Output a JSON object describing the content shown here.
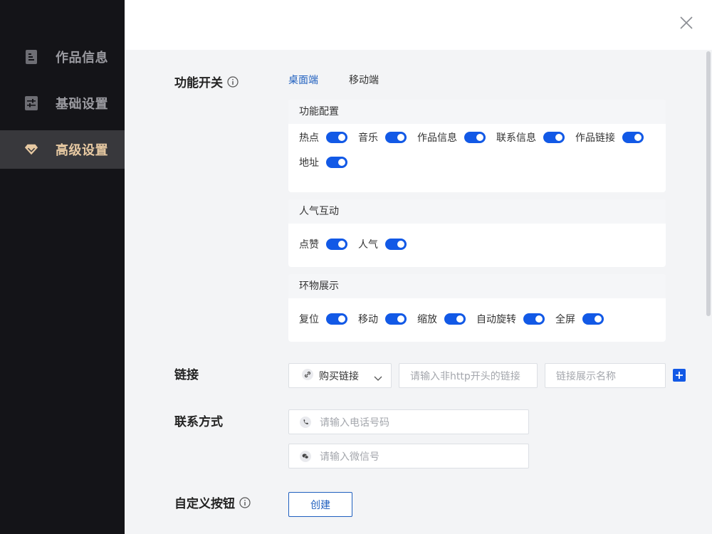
{
  "sidebar": {
    "items": [
      {
        "label": "作品信息",
        "icon": "document-icon",
        "active": false
      },
      {
        "label": "基础设置",
        "icon": "sliders-icon",
        "active": false
      },
      {
        "label": "高级设置",
        "icon": "diamond-icon",
        "active": true
      }
    ]
  },
  "header": {
    "close_icon": "close-icon"
  },
  "features": {
    "label": "功能开关",
    "tabs": [
      {
        "label": "桌面端",
        "active": true
      },
      {
        "label": "移动端",
        "active": false
      }
    ],
    "groups": [
      {
        "title": "功能配置",
        "toggles": [
          {
            "label": "热点",
            "on": true
          },
          {
            "label": "音乐",
            "on": true
          },
          {
            "label": "作品信息",
            "on": true
          },
          {
            "label": "联系信息",
            "on": true
          },
          {
            "label": "作品链接",
            "on": true
          },
          {
            "label": "地址",
            "on": true
          }
        ]
      },
      {
        "title": "人气互动",
        "toggles": [
          {
            "label": "点赞",
            "on": true
          },
          {
            "label": "人气",
            "on": true
          }
        ]
      },
      {
        "title": "环物展示",
        "toggles": [
          {
            "label": "复位",
            "on": true
          },
          {
            "label": "移动",
            "on": true
          },
          {
            "label": "缩放",
            "on": true
          },
          {
            "label": "自动旋转",
            "on": true
          },
          {
            "label": "全屏",
            "on": true
          }
        ]
      }
    ]
  },
  "link": {
    "label": "链接",
    "select_value": "购买链接",
    "url_placeholder": "请输入非http开头的链接",
    "name_placeholder": "链接展示名称"
  },
  "contact": {
    "label": "联系方式",
    "phone_placeholder": "请输入电话号码",
    "wechat_placeholder": "请输入微信号"
  },
  "custom_button": {
    "label": "自定义按钮",
    "create_label": "创建"
  },
  "colors": {
    "accent": "#1259e6",
    "active_tab": "#1f5fbf",
    "sidebar_bg": "#141418",
    "active_nav_text": "#e7c9a2"
  }
}
